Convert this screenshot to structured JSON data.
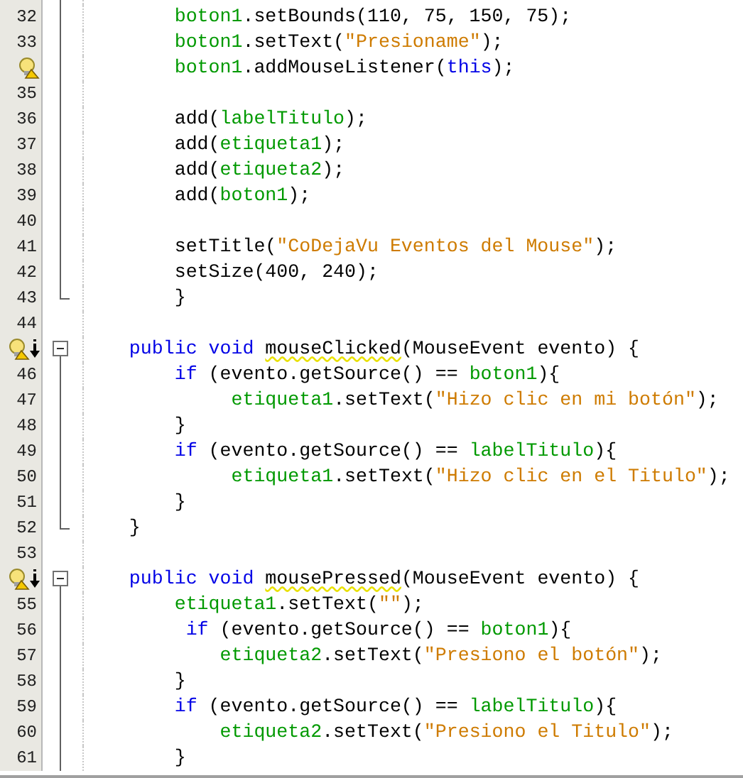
{
  "editor": {
    "lines": [
      {
        "number": "32",
        "hint": false,
        "override": false,
        "fold_start": false,
        "fold_guide": true,
        "fold_end": false,
        "tokens": [
          {
            "kind": "field",
            "text": "        boton1"
          },
          {
            "kind": "plain",
            "text": ".setBounds(110, 75, 150, 75);"
          }
        ]
      },
      {
        "number": "33",
        "hint": false,
        "override": false,
        "fold_start": false,
        "fold_guide": true,
        "fold_end": false,
        "tokens": [
          {
            "kind": "field",
            "text": "        boton1"
          },
          {
            "kind": "plain",
            "text": ".setText("
          },
          {
            "kind": "string",
            "text": "\"Presioname\""
          },
          {
            "kind": "plain",
            "text": ");"
          }
        ]
      },
      {
        "hint": true,
        "override": false,
        "fold_start": false,
        "fold_guide": true,
        "fold_end": false,
        "tokens": [
          {
            "kind": "field",
            "text": "        boton1"
          },
          {
            "kind": "plain",
            "text": ".addMouseListener("
          },
          {
            "kind": "keyword",
            "text": "this"
          },
          {
            "kind": "plain",
            "text": ");"
          }
        ]
      },
      {
        "number": "35",
        "hint": false,
        "override": false,
        "fold_start": false,
        "fold_guide": true,
        "fold_end": false
      },
      {
        "number": "36",
        "hint": false,
        "override": false,
        "fold_start": false,
        "fold_guide": true,
        "fold_end": false,
        "tokens": [
          {
            "kind": "plain",
            "text": "        add("
          },
          {
            "kind": "field",
            "text": "labelTitulo"
          },
          {
            "kind": "plain",
            "text": ");"
          }
        ]
      },
      {
        "number": "37",
        "hint": false,
        "override": false,
        "fold_start": false,
        "fold_guide": true,
        "fold_end": false,
        "tokens": [
          {
            "kind": "plain",
            "text": "        add("
          },
          {
            "kind": "field",
            "text": "etiqueta1"
          },
          {
            "kind": "plain",
            "text": ");"
          }
        ]
      },
      {
        "number": "38",
        "hint": false,
        "override": false,
        "fold_start": false,
        "fold_guide": true,
        "fold_end": false,
        "tokens": [
          {
            "kind": "plain",
            "text": "        add("
          },
          {
            "kind": "field",
            "text": "etiqueta2"
          },
          {
            "kind": "plain",
            "text": ");"
          }
        ]
      },
      {
        "number": "39",
        "hint": false,
        "override": false,
        "fold_start": false,
        "fold_guide": true,
        "fold_end": false,
        "tokens": [
          {
            "kind": "plain",
            "text": "        add("
          },
          {
            "kind": "field",
            "text": "boton1"
          },
          {
            "kind": "plain",
            "text": ");"
          }
        ]
      },
      {
        "number": "40",
        "hint": false,
        "override": false,
        "fold_start": false,
        "fold_guide": true,
        "fold_end": false
      },
      {
        "number": "41",
        "hint": false,
        "override": false,
        "fold_start": false,
        "fold_guide": true,
        "fold_end": false,
        "tokens": [
          {
            "kind": "plain",
            "text": "        setTitle("
          },
          {
            "kind": "string",
            "text": "\"CoDejaVu Eventos del Mouse\""
          },
          {
            "kind": "plain",
            "text": ");"
          }
        ]
      },
      {
        "number": "42",
        "hint": false,
        "override": false,
        "fold_start": false,
        "fold_guide": true,
        "fold_end": false,
        "tokens": [
          {
            "kind": "plain",
            "text": "        setSize(400, 240);"
          }
        ]
      },
      {
        "number": "43",
        "hint": false,
        "override": false,
        "fold_start": false,
        "fold_guide": false,
        "fold_end": true,
        "tokens": [
          {
            "kind": "plain",
            "text": "        }"
          }
        ]
      },
      {
        "number": "44",
        "hint": false,
        "override": false,
        "fold_start": false,
        "fold_guide": false,
        "fold_end": false
      },
      {
        "hint": true,
        "override": true,
        "fold_start": true,
        "fold_guide": false,
        "fold_end": false,
        "tokens": [
          {
            "kind": "keyword",
            "text": "    public void "
          },
          {
            "kind": "method",
            "text": "mouseClicked"
          },
          {
            "kind": "plain",
            "text": "(MouseEvent evento) {"
          }
        ]
      },
      {
        "number": "46",
        "hint": false,
        "override": false,
        "fold_start": false,
        "fold_guide": true,
        "fold_end": false,
        "tokens": [
          {
            "kind": "keyword",
            "text": "        if"
          },
          {
            "kind": "plain",
            "text": " (evento.getSource() == "
          },
          {
            "kind": "field",
            "text": "boton1"
          },
          {
            "kind": "plain",
            "text": "){"
          }
        ]
      },
      {
        "number": "47",
        "hint": false,
        "override": false,
        "fold_start": false,
        "fold_guide": true,
        "fold_end": false,
        "tokens": [
          {
            "kind": "field",
            "text": "             etiqueta1"
          },
          {
            "kind": "plain",
            "text": ".setText("
          },
          {
            "kind": "string",
            "text": "\"Hizo clic en mi botón\""
          },
          {
            "kind": "plain",
            "text": ");"
          }
        ]
      },
      {
        "number": "48",
        "hint": false,
        "override": false,
        "fold_start": false,
        "fold_guide": true,
        "fold_end": false,
        "tokens": [
          {
            "kind": "plain",
            "text": "        }"
          }
        ]
      },
      {
        "number": "49",
        "hint": false,
        "override": false,
        "fold_start": false,
        "fold_guide": true,
        "fold_end": false,
        "tokens": [
          {
            "kind": "keyword",
            "text": "        if"
          },
          {
            "kind": "plain",
            "text": " (evento.getSource() == "
          },
          {
            "kind": "field",
            "text": "labelTitulo"
          },
          {
            "kind": "plain",
            "text": "){"
          }
        ]
      },
      {
        "number": "50",
        "hint": false,
        "override": false,
        "fold_start": false,
        "fold_guide": true,
        "fold_end": false,
        "tokens": [
          {
            "kind": "field",
            "text": "             etiqueta1"
          },
          {
            "kind": "plain",
            "text": ".setText("
          },
          {
            "kind": "string",
            "text": "\"Hizo clic en el Titulo\""
          },
          {
            "kind": "plain",
            "text": ");"
          }
        ]
      },
      {
        "number": "51",
        "hint": false,
        "override": false,
        "fold_start": false,
        "fold_guide": true,
        "fold_end": false,
        "tokens": [
          {
            "kind": "plain",
            "text": "        }"
          }
        ]
      },
      {
        "number": "52",
        "hint": false,
        "override": false,
        "fold_start": false,
        "fold_guide": false,
        "fold_end": true,
        "tokens": [
          {
            "kind": "plain",
            "text": "    }"
          }
        ]
      },
      {
        "number": "53",
        "hint": false,
        "override": false,
        "fold_start": false,
        "fold_guide": false,
        "fold_end": false
      },
      {
        "hint": true,
        "override": true,
        "fold_start": true,
        "fold_guide": false,
        "fold_end": false,
        "tokens": [
          {
            "kind": "keyword",
            "text": "    public void "
          },
          {
            "kind": "method",
            "text": "mousePressed"
          },
          {
            "kind": "plain",
            "text": "(MouseEvent evento) {"
          }
        ]
      },
      {
        "number": "55",
        "hint": false,
        "override": false,
        "fold_start": false,
        "fold_guide": true,
        "fold_end": false,
        "tokens": [
          {
            "kind": "field",
            "text": "        etiqueta1"
          },
          {
            "kind": "plain",
            "text": ".setText("
          },
          {
            "kind": "string",
            "text": "\"\""
          },
          {
            "kind": "plain",
            "text": ");"
          }
        ]
      },
      {
        "number": "56",
        "hint": false,
        "override": false,
        "fold_start": false,
        "fold_guide": true,
        "fold_end": false,
        "tokens": [
          {
            "kind": "keyword",
            "text": "         if"
          },
          {
            "kind": "plain",
            "text": " (evento.getSource() == "
          },
          {
            "kind": "field",
            "text": "boton1"
          },
          {
            "kind": "plain",
            "text": "){"
          }
        ]
      },
      {
        "number": "57",
        "hint": false,
        "override": false,
        "fold_start": false,
        "fold_guide": true,
        "fold_end": false,
        "tokens": [
          {
            "kind": "field",
            "text": "            etiqueta2"
          },
          {
            "kind": "plain",
            "text": ".setText("
          },
          {
            "kind": "string",
            "text": "\"Presiono el botón\""
          },
          {
            "kind": "plain",
            "text": ");"
          }
        ]
      },
      {
        "number": "58",
        "hint": false,
        "override": false,
        "fold_start": false,
        "fold_guide": true,
        "fold_end": false,
        "tokens": [
          {
            "kind": "plain",
            "text": "        }"
          }
        ]
      },
      {
        "number": "59",
        "hint": false,
        "override": false,
        "fold_start": false,
        "fold_guide": true,
        "fold_end": false,
        "tokens": [
          {
            "kind": "keyword",
            "text": "        if"
          },
          {
            "kind": "plain",
            "text": " (evento.getSource() == "
          },
          {
            "kind": "field",
            "text": "labelTitulo"
          },
          {
            "kind": "plain",
            "text": "){"
          }
        ]
      },
      {
        "number": "60",
        "hint": false,
        "override": false,
        "fold_start": false,
        "fold_guide": true,
        "fold_end": false,
        "tokens": [
          {
            "kind": "field",
            "text": "            etiqueta2"
          },
          {
            "kind": "plain",
            "text": ".setText("
          },
          {
            "kind": "string",
            "text": "\"Presiono el Titulo\""
          },
          {
            "kind": "plain",
            "text": ");"
          }
        ]
      },
      {
        "number": "61",
        "hint": false,
        "override": false,
        "fold_start": false,
        "fold_guide": true,
        "fold_end": false,
        "tokens": [
          {
            "kind": "plain",
            "text": "        }"
          }
        ]
      }
    ]
  }
}
